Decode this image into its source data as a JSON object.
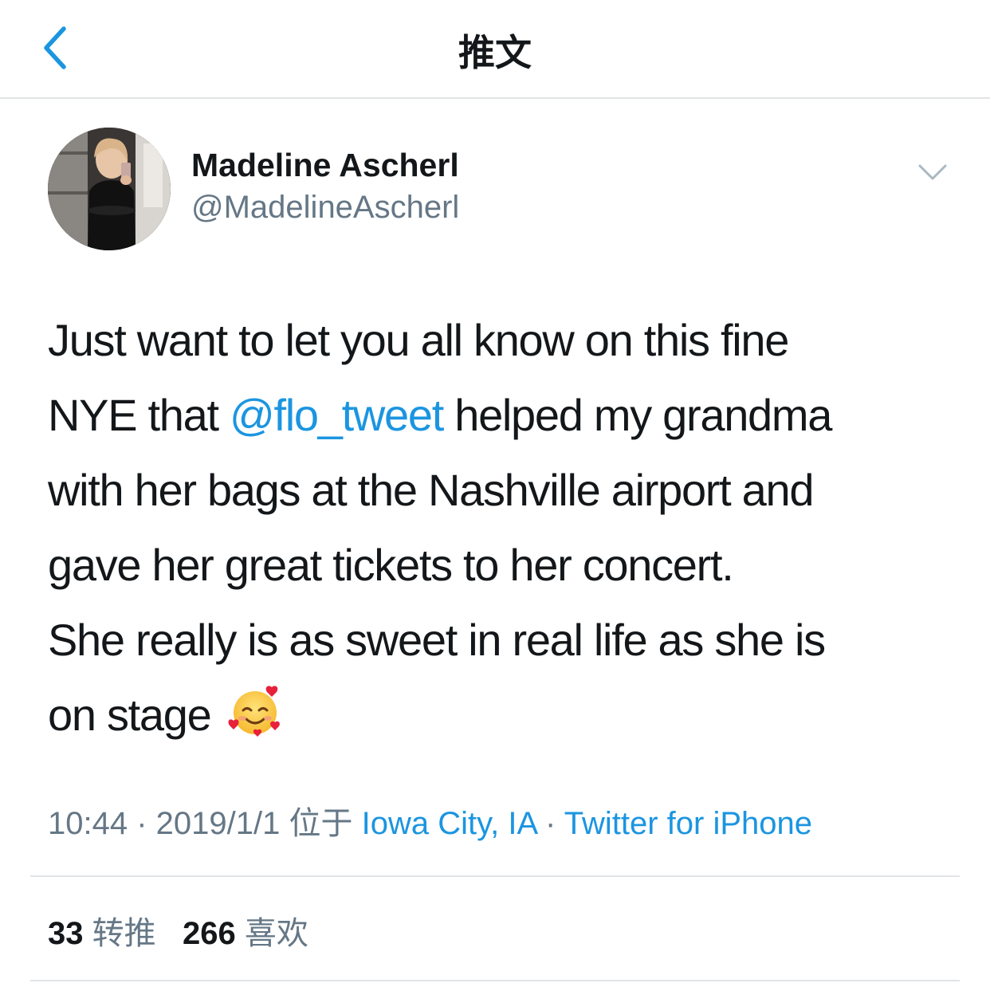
{
  "header": {
    "title": "推文",
    "back_icon": "chevron-left-icon"
  },
  "author": {
    "name": "Madeline Ascherl",
    "handle": "@MadelineAscherl"
  },
  "tweet": {
    "lines": [
      {
        "text": "Just want to let you all know on this fine"
      },
      {
        "before": "NYE that ",
        "mention": "@flo_tweet",
        "after": " helped my grandma"
      },
      {
        "text": "with her bags at the Nashville airport and"
      },
      {
        "text": "gave her great tickets to her concert."
      },
      {
        "text": "She really is as sweet in real life as she is"
      },
      {
        "text": "on stage",
        "emoji": "smiling-face-with-hearts-icon"
      }
    ]
  },
  "meta": {
    "time": "10:44",
    "sep1": " · ",
    "date": "2019/1/1",
    "location_prefix": " 位于 ",
    "location": "Iowa City, IA",
    "sep2": " · ",
    "source": "Twitter for iPhone"
  },
  "stats": {
    "retweets_count": "33",
    "retweets_label": "转推",
    "likes_count": "266",
    "likes_label": "喜欢"
  },
  "colors": {
    "link": "#1b95e0",
    "secondary_text": "#657786",
    "divider": "#e1e4e6"
  }
}
